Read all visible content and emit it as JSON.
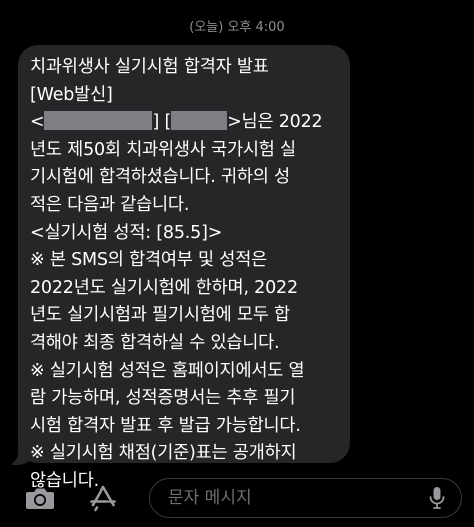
{
  "header": {
    "timestamp": "(오늘) 오후 4:00"
  },
  "message": {
    "lines": [
      "치과위생사 실기시험 합격자 발표",
      "[Web발신]",
      "년도 제50회 치과위생사 국가시험 실",
      "기시험에 합격하셨습니다. 귀하의 성",
      "적은 다음과 같습니다.",
      "<실기시험 성적: [85.5]>",
      "※ 본 SMS의 합격여부 및 성적은",
      "2022년도 실기시험에 한하며, 2022",
      "년도 실기시험과 필기시험에 모두 합",
      "격해야 최종 합격하실 수 있습니다.",
      "※ 실기시험 성적은 홈페이지에서도 열",
      "람 가능하며, 성적증명서는 추후 필기",
      "시험 합격자 발표 후 발급 가능합니다.",
      "※ 실기시험 채점(기준)표는 공개하지",
      "않습니다."
    ],
    "greeting": {
      "open": "<",
      "mid": "] [",
      "close": ">님은 2022"
    }
  },
  "composer": {
    "placeholder": "문자 메시지",
    "icons": [
      "camera-icon",
      "app-store-icon",
      "microphone-icon"
    ]
  },
  "colors": {
    "background": "#000000",
    "bubble": "#262629",
    "timestamp": "#8e8e93",
    "redaction": "#7e7e84",
    "icon": "#98989d"
  }
}
